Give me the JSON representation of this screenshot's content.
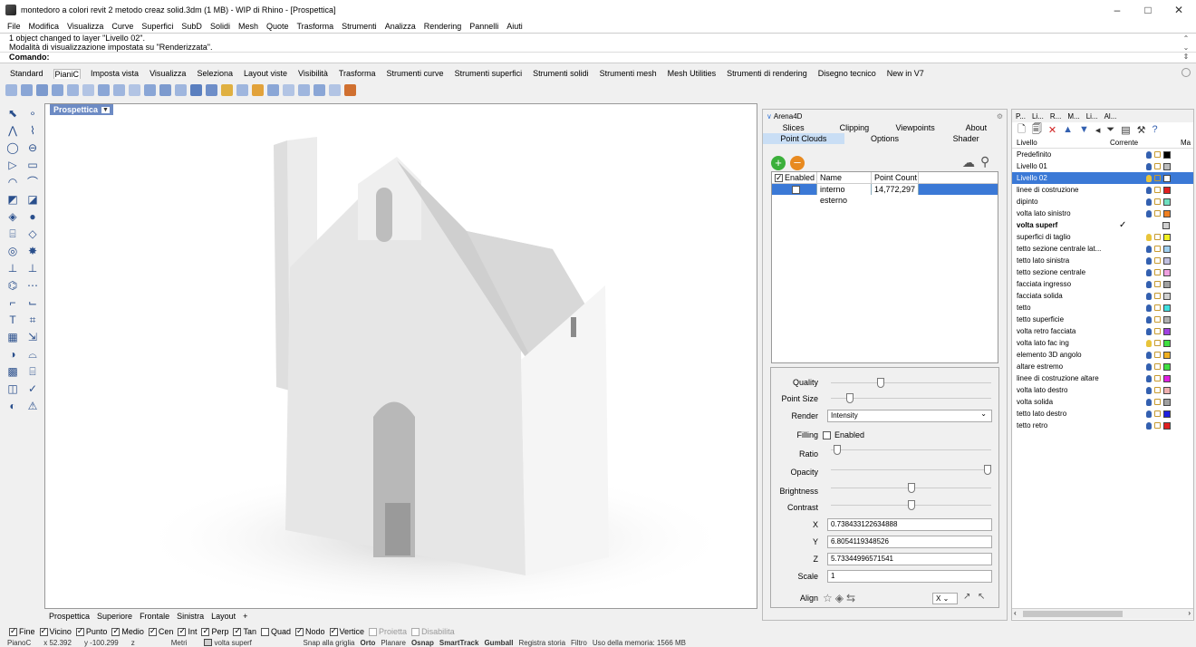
{
  "window": {
    "title": "montedoro a colori revit 2 metodo creaz solid.3dm (1 MB) - WIP di Rhino - [Prospettica]",
    "minimize": "–",
    "maximize": "□",
    "close": "✕"
  },
  "menu": [
    "File",
    "Modifica",
    "Visualizza",
    "Curve",
    "Superfici",
    "SubD",
    "Solidi",
    "Mesh",
    "Quote",
    "Trasforma",
    "Strumenti",
    "Analizza",
    "Rendering",
    "Pannelli",
    "Aiuti"
  ],
  "command": {
    "history": [
      "1 object changed to layer \"Livello 02\".",
      "Modalità di visualizzazione impostata su \"Renderizzata\"."
    ],
    "prompt": "Comando:"
  },
  "toolbar_tabs": [
    "Standard",
    "PianiC",
    "Imposta vista",
    "Visualizza",
    "Seleziona",
    "Layout viste",
    "Visibilità",
    "Trasforma",
    "Strumenti curve",
    "Strumenti superfici",
    "Strumenti solidi",
    "Strumenti mesh",
    "Mesh Utilities",
    "Strumenti di rendering",
    "Disegno tecnico",
    "New in V7"
  ],
  "toolbar_active_tab": "PianiC",
  "viewport": {
    "label": "Prospettica"
  },
  "view_tabs": [
    "Prospettica",
    "Superiore",
    "Frontale",
    "Sinistra",
    "Layout",
    "+"
  ],
  "osnaps": [
    {
      "label": "Fine",
      "on": true
    },
    {
      "label": "Vicino",
      "on": true
    },
    {
      "label": "Punto",
      "on": true
    },
    {
      "label": "Medio",
      "on": true
    },
    {
      "label": "Cen",
      "on": true
    },
    {
      "label": "Int",
      "on": true
    },
    {
      "label": "Perp",
      "on": true
    },
    {
      "label": "Tan",
      "on": true
    },
    {
      "label": "Quad",
      "on": false
    },
    {
      "label": "Nodo",
      "on": true
    },
    {
      "label": "Vertice",
      "on": true
    },
    {
      "label": "Proietta",
      "on": false,
      "disabled": true
    },
    {
      "label": "Disabilita",
      "on": false,
      "disabled": true
    }
  ],
  "status": {
    "cplane": "PianoC",
    "x": "x 52.392",
    "y": "y -100.299",
    "z": "z",
    "units": "Metri",
    "layer": "volta superf",
    "snap": "Snap alla griglia",
    "ortho": "Orto",
    "planar": "Planare",
    "osnap": "Osnap",
    "smarttrack": "SmartTrack",
    "gumball": "Gumball",
    "history": "Registra storia",
    "filter": "Filtro",
    "memory": "Uso della memoria: 1566 MB"
  },
  "arena": {
    "title": "Arena4D",
    "tabs_row1": [
      "Slices",
      "Clipping",
      "Viewpoints",
      "About"
    ],
    "tabs_row2": [
      "Point Clouds",
      "Options",
      "Shader"
    ],
    "table_headers": {
      "enabled": "Enabled",
      "name": "Name",
      "count": "Point Count"
    },
    "rows": [
      {
        "name": "interno esterno",
        "count": "14,772,297"
      }
    ],
    "controls": {
      "quality": "Quality",
      "point_size": "Point Size",
      "render": "Render",
      "render_value": "Intensity",
      "filling": "Filling",
      "filling_opt": "Enabled",
      "ratio": "Ratio",
      "opacity": "Opacity",
      "brightness": "Brightness",
      "contrast": "Contrast",
      "x_label": "X",
      "x": "0.738433122634888",
      "y_label": "Y",
      "y": "6.8054119348526",
      "z_label": "Z",
      "z": "5.73344996571541",
      "scale_label": "Scale",
      "scale": "1",
      "align": "Align",
      "axis": "X"
    },
    "slider_levels": {
      "quality": 0.3,
      "point_size": 0.1,
      "ratio": 0.02,
      "opacity": 1.0,
      "brightness": 0.5,
      "contrast": 0.5
    }
  },
  "layers": {
    "panel_tabs": [
      "P...",
      "Li...",
      "R...",
      "M...",
      "Li...",
      "Al..."
    ],
    "headers": {
      "name": "Livello",
      "current": "Corrente",
      "mat": "Ma"
    },
    "items": [
      {
        "name": "Predefinito",
        "color": "#000000"
      },
      {
        "name": "Livello 01",
        "color": "#bbbbbb"
      },
      {
        "name": "Livello 02",
        "color": "#ffffff",
        "selected": true
      },
      {
        "name": "linee di costruzione",
        "color": "#e02020"
      },
      {
        "name": "dipinto",
        "color": "#70e0c0"
      },
      {
        "name": "volta lato sinistro",
        "color": "#f08020"
      },
      {
        "name": "volta superf",
        "color": "#d0d0d0",
        "current": true
      },
      {
        "name": "superfici di taglio",
        "color": "#f0f020"
      },
      {
        "name": "tetto sezione centrale lat...",
        "color": "#a0d0f0"
      },
      {
        "name": "tetto lato sinistra",
        "color": "#c0c0e0"
      },
      {
        "name": "tetto sezione centrale",
        "color": "#f0a0e0"
      },
      {
        "name": "facciata ingresso",
        "color": "#a0a0a0"
      },
      {
        "name": "facciata solida",
        "color": "#d0d0d0"
      },
      {
        "name": "tetto",
        "color": "#40e0e0"
      },
      {
        "name": "tetto superficie",
        "color": "#b0b0b0"
      },
      {
        "name": "volta retro facciata",
        "color": "#a040e0"
      },
      {
        "name": "volta lato fac ing",
        "color": "#40e040"
      },
      {
        "name": "elemento 3D angolo",
        "color": "#f0b020"
      },
      {
        "name": "altare estremo",
        "color": "#40e040"
      },
      {
        "name": "linee di costruzione altare",
        "color": "#e020e0"
      },
      {
        "name": "volta lato destro",
        "color": "#f0b0b0"
      },
      {
        "name": "volta solida",
        "color": "#a0a0a0"
      },
      {
        "name": "tetto lato destro",
        "color": "#2020e0"
      },
      {
        "name": "tetto retro",
        "color": "#e02020"
      }
    ]
  }
}
